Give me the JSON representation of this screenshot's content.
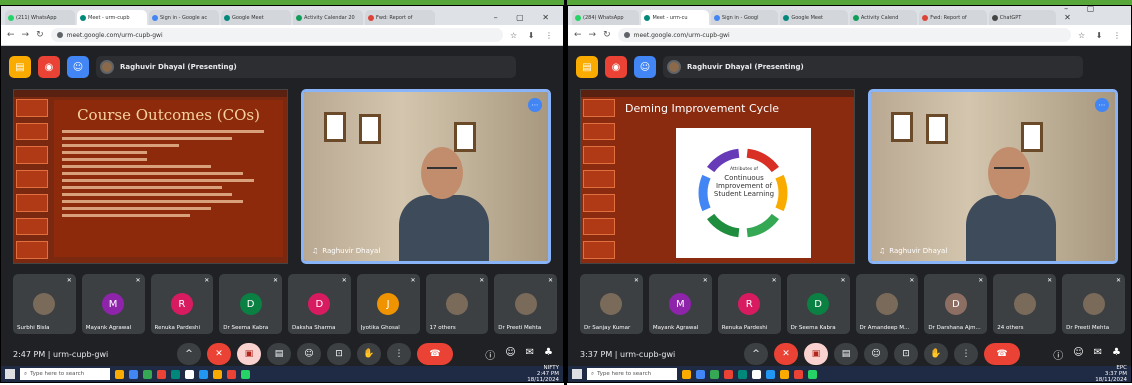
{
  "screens": [
    {
      "tabs": [
        {
          "label": "(211) WhatsApp",
          "active": false,
          "color": "#25d366"
        },
        {
          "label": "Meet - urm-cupb",
          "active": true,
          "color": "#00897b"
        },
        {
          "label": "Sign in - Google ac",
          "active": false,
          "color": "#4285f4"
        },
        {
          "label": "Google Meet",
          "active": false,
          "color": "#00897b"
        },
        {
          "label": "Activity Calendar 20",
          "active": false,
          "color": "#0f9d58"
        },
        {
          "label": "Fwd: Report of",
          "active": false,
          "color": "#db4437"
        }
      ],
      "url": "meet.google.com/urm-cupb-gwi",
      "presenter": "Raghuvir Dhayal (Presenting)",
      "slide": {
        "title": "Course Outcomes (COs)",
        "kind": "text"
      },
      "speaker_name": "Raghuvir Dhayal",
      "participants": [
        {
          "name": "Surbhi Bisla",
          "initial": "",
          "color": "#7a6a5a"
        },
        {
          "name": "Mayank Agrawal",
          "initial": "M",
          "color": "#8e24aa"
        },
        {
          "name": "Renuka Pardeshi",
          "initial": "R",
          "color": "#d81b60"
        },
        {
          "name": "Dr Seema Kabra",
          "initial": "D",
          "color": "#0b8043"
        },
        {
          "name": "Daksha Sharma",
          "initial": "D",
          "color": "#d81b60"
        },
        {
          "name": "Jyotika Ghosal",
          "initial": "J",
          "color": "#f09300"
        },
        {
          "name": "17 others",
          "initial": "",
          "color": "#7a6a5a"
        },
        {
          "name": "Dr Preeti Mehta",
          "initial": "",
          "color": "#7a6a5a"
        }
      ],
      "time_meeting": "2:47 PM | urm-cupb-gwi",
      "taskbar_search": "Type here to search",
      "tray_text": "NIFTY",
      "tray_time": "2:47 PM",
      "tray_date": "18/11/2024"
    },
    {
      "tabs": [
        {
          "label": "(284) WhatsApp",
          "active": false,
          "color": "#25d366"
        },
        {
          "label": "Meet - urm-cu",
          "active": true,
          "color": "#00897b"
        },
        {
          "label": "Sign in - Googl",
          "active": false,
          "color": "#4285f4"
        },
        {
          "label": "Google Meet",
          "active": false,
          "color": "#00897b"
        },
        {
          "label": "Activity Calend",
          "active": false,
          "color": "#0f9d58"
        },
        {
          "label": "Fwd: Report of",
          "active": false,
          "color": "#db4437"
        },
        {
          "label": "ChatGPT",
          "active": false,
          "color": "#444444"
        }
      ],
      "url": "meet.google.com/urm-cupb-gwi",
      "presenter": "Raghuvir Dhayal (Presenting)",
      "slide": {
        "title": "Deming Improvement Cycle",
        "kind": "diagram",
        "center_line1": "Attributes of",
        "center_main": "Continuous Improvement of Student Learning"
      },
      "speaker_name": "Raghuvir Dhayal",
      "participants": [
        {
          "name": "Dr Sanjay Kumar",
          "initial": "",
          "color": "#7a6a5a"
        },
        {
          "name": "Mayank Agrawal",
          "initial": "M",
          "color": "#8e24aa"
        },
        {
          "name": "Renuka Pardeshi",
          "initial": "R",
          "color": "#d81b60"
        },
        {
          "name": "Dr Seema Kabra",
          "initial": "D",
          "color": "#0b8043"
        },
        {
          "name": "Dr Amandeep M...",
          "initial": "",
          "color": "#7a6a5a"
        },
        {
          "name": "Dr Darshana Ajm...",
          "initial": "D",
          "color": "#8d6e63"
        },
        {
          "name": "24 others",
          "initial": "",
          "color": "#7a6a5a"
        },
        {
          "name": "Dr Preeti Mehta",
          "initial": "",
          "color": "#7a6a5a"
        }
      ],
      "time_meeting": "3:37 PM | urm-cupb-gwi",
      "taskbar_search": "Type here to search",
      "tray_text": "EPC",
      "tray_time": "3:37 PM",
      "tray_date": "18/11/2024"
    }
  ]
}
